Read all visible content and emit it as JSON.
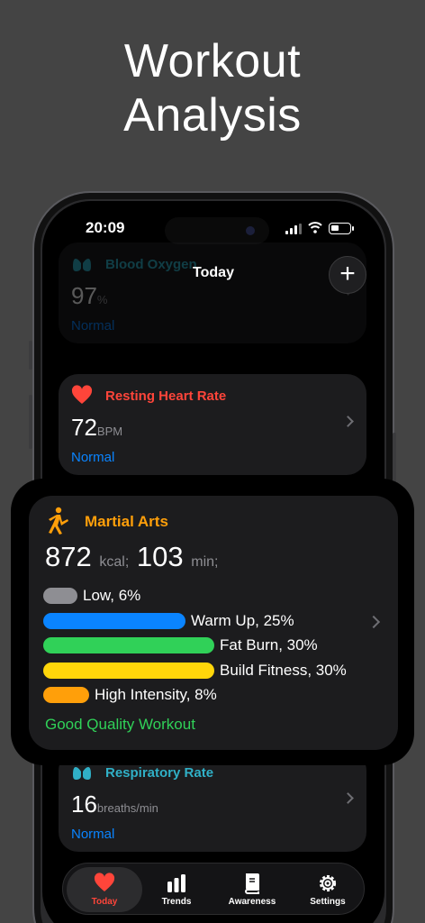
{
  "headline": {
    "line1": "Workout",
    "line2": "Analysis"
  },
  "status_bar": {
    "time": "20:09"
  },
  "nav": {
    "title": "Today",
    "add_label": "+"
  },
  "cards": {
    "blood_oxygen": {
      "title": "Blood Oxygen",
      "value": "97",
      "unit": "%",
      "status": "Normal",
      "color": "#30b0c7"
    },
    "resting_hr": {
      "title": "Resting Heart Rate",
      "value": "72",
      "unit": "BPM",
      "status": "Normal",
      "color": "#ff453a"
    },
    "respiratory": {
      "title": "Respiratory Rate",
      "value": "16",
      "unit": "breaths/min",
      "status": "Normal",
      "color": "#30b0c7"
    }
  },
  "workout": {
    "title": "Martial Arts",
    "kcal": "872",
    "kcal_unit": "kcal;",
    "minutes": "103",
    "min_unit": "min;",
    "quality": "Good Quality Workout",
    "accent": "#ff9f0a",
    "zones": [
      {
        "label": "Low, 6%",
        "percent": 6,
        "color": "#8e8e93"
      },
      {
        "label": "Warm Up, 25%",
        "percent": 25,
        "color": "#0a84ff"
      },
      {
        "label": "Fat Burn, 30%",
        "percent": 30,
        "color": "#30d158"
      },
      {
        "label": "Build Fitness, 30%",
        "percent": 30,
        "color": "#ffd60a"
      },
      {
        "label": "High Intensity, 8%",
        "percent": 8,
        "color": "#ff9f0a"
      }
    ]
  },
  "tabs": [
    {
      "label": "Today",
      "icon": "heart-icon",
      "active": true,
      "color": "#ff453a"
    },
    {
      "label": "Trends",
      "icon": "bar-chart-icon",
      "active": false
    },
    {
      "label": "Awareness",
      "icon": "book-icon",
      "active": false
    },
    {
      "label": "Settings",
      "icon": "gear-icon",
      "active": false
    }
  ]
}
